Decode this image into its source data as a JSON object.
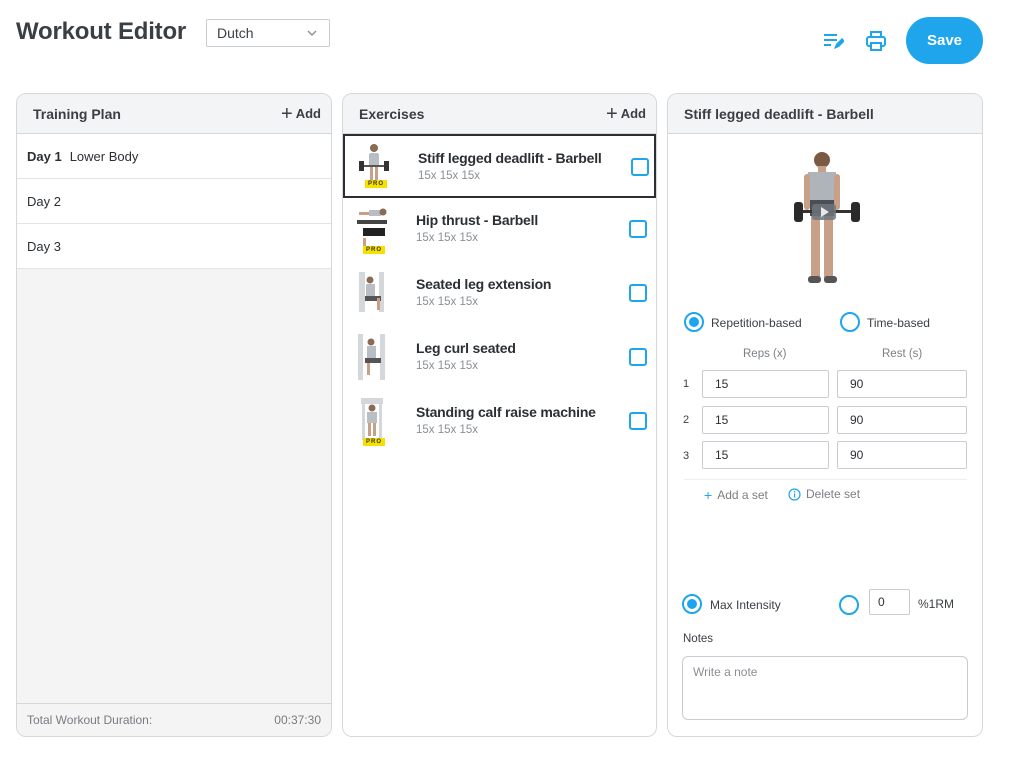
{
  "header": {
    "title": "Workout Editor",
    "language": "Dutch",
    "save_label": "Save",
    "accent_color": "#1ea5ec"
  },
  "plan": {
    "title": "Training Plan",
    "add_label": "Add",
    "days": [
      {
        "label": "Day 1",
        "name": "Lower Body"
      },
      {
        "label": "Day 2",
        "name": ""
      },
      {
        "label": "Day 3",
        "name": ""
      }
    ],
    "footer_label": "Total Workout Duration:",
    "footer_value": "00:37:30"
  },
  "exercises": {
    "title": "Exercises",
    "add_label": "Add",
    "items": [
      {
        "name": "Stiff legged deadlift - Barbell",
        "sets": "15x 15x 15x",
        "pro": true,
        "icon": "deadlift-thumbnail"
      },
      {
        "name": "Hip thrust - Barbell",
        "sets": "15x 15x 15x",
        "pro": true,
        "icon": "hip-thrust-thumbnail"
      },
      {
        "name": "Seated leg extension",
        "sets": "15x 15x 15x",
        "pro": false,
        "icon": "leg-extension-thumbnail"
      },
      {
        "name": "Leg curl seated",
        "sets": "15x 15x 15x",
        "pro": false,
        "icon": "leg-curl-thumbnail"
      },
      {
        "name": "Standing calf raise machine",
        "sets": "15x 15x 15x",
        "pro": true,
        "icon": "calf-raise-thumbnail"
      }
    ],
    "pro_badge": "PRO"
  },
  "detail": {
    "title": "Stiff legged deadlift - Barbell",
    "mode_rep": "Repetition-based",
    "mode_time": "Time-based",
    "col_reps": "Reps (x)",
    "col_rest": "Rest (s)",
    "sets": [
      {
        "num": "1",
        "reps": "15",
        "rest": "90"
      },
      {
        "num": "2",
        "reps": "15",
        "rest": "90"
      },
      {
        "num": "3",
        "reps": "15",
        "rest": "90"
      }
    ],
    "add_set": "Add a set",
    "delete_set": "Delete set",
    "max_intensity": "Max Intensity",
    "rm_value": "0",
    "rm_unit": "%1RM",
    "notes_label": "Notes",
    "notes_placeholder": "Write a note"
  }
}
